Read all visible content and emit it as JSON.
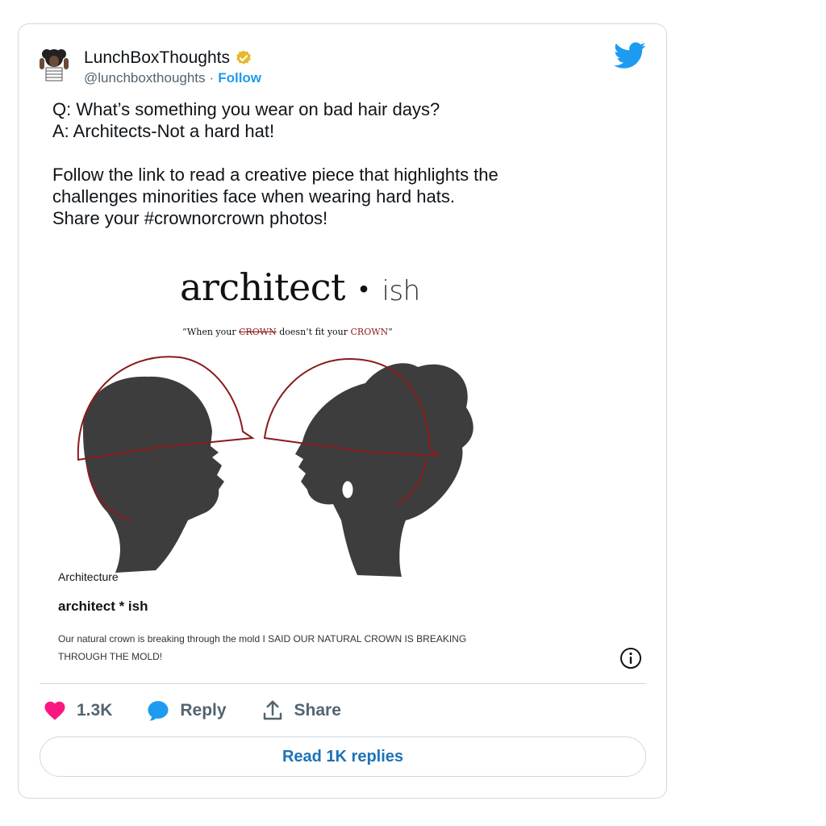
{
  "author": {
    "display_name": "LunchBoxThoughts",
    "handle": "@lunchboxthoughts",
    "separator": "·",
    "follow_label": "Follow"
  },
  "tweet": {
    "lines": [
      "Q: What’s something you wear on bad hair days?",
      "A: Architects-Not a hard hat!",
      "Follow the link to read a creative piece that highlights the",
      "challenges minorities face when wearing hard hats.",
      "Share your #crownorcrown photos!"
    ]
  },
  "artwork": {
    "title_main": "architect",
    "title_dot": "•",
    "title_suffix": "ish",
    "tagline_prefix": "“When your ",
    "tagline_strike": "CROWN",
    "tagline_middle": " doesn’t fit your ",
    "tagline_red": "CROWN",
    "tagline_suffix": "”"
  },
  "link_card": {
    "category": "Architecture",
    "title": "architect * ish",
    "description": "Our natural crown is breaking through the mold I SAID OUR NATURAL CROWN IS BREAKING THROUGH THE MOLD!"
  },
  "actions": {
    "like_count": "1.3K",
    "reply_label": "Reply",
    "share_label": "Share",
    "read_replies_label": "Read 1K replies"
  },
  "colors": {
    "accent": "#1d9bf0",
    "like": "#f91880",
    "hat": "#8b1a1a"
  },
  "icons": [
    "avatar",
    "verified-badge-icon",
    "twitter-bird-icon",
    "info-icon",
    "heart-icon",
    "reply-bubble-icon",
    "share-icon"
  ]
}
